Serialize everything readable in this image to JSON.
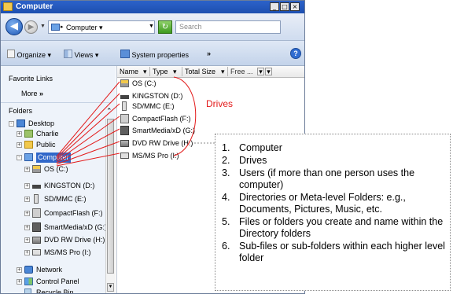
{
  "window": {
    "title": "Computer",
    "min_label": "_",
    "max_label": "□",
    "close_label": "×"
  },
  "address": {
    "path": "Computer",
    "search_placeholder": "Search"
  },
  "toolbar": {
    "organize": "Organize",
    "views": "Views",
    "system_properties": "System properties",
    "more": "»",
    "help": "?"
  },
  "nav": {
    "favorites_header": "Favorite Links",
    "more_label": "More",
    "more_chevron": "»",
    "folders_header": "Folders",
    "tree": [
      {
        "label": "Desktop",
        "icon": "desktop-icon"
      },
      {
        "label": "Charlie",
        "icon": "user-folder-icon"
      },
      {
        "label": "Public",
        "icon": "folder-icon"
      },
      {
        "label": "Computer",
        "icon": "computer-icon"
      },
      {
        "label": "OS (C:)",
        "icon": "os-drive-icon"
      },
      {
        "label": "KINGSTON (D:)",
        "icon": "usb-drive-icon"
      },
      {
        "label": "SD/MMC (E:)",
        "icon": "card-reader-icon"
      },
      {
        "label": "CompactFlash (F:)",
        "icon": "card-reader-icon"
      },
      {
        "label": "SmartMedia/xD (G:)",
        "icon": "card-reader-icon"
      },
      {
        "label": "DVD RW Drive (H:)",
        "icon": "dvd-drive-icon"
      },
      {
        "label": "MS/MS Pro (I:)",
        "icon": "card-reader-icon"
      },
      {
        "label": "Network",
        "icon": "network-icon"
      },
      {
        "label": "Control Panel",
        "icon": "control-panel-icon"
      },
      {
        "label": "Recycle Bin",
        "icon": "recycle-bin-icon"
      }
    ]
  },
  "file_pane": {
    "columns": [
      "Name",
      "Type",
      "Total Size",
      "Free ..."
    ],
    "drives": [
      "OS (C:)",
      "KINGSTON (D:)",
      "SD/MMC (E:)",
      "CompactFlash (F:)",
      "SmartMedia/xD (G:)",
      "DVD RW Drive (H:)",
      "MS/MS Pro (I:)"
    ]
  },
  "annotation": {
    "drives_label": "Drives",
    "line_color": "#e31a1a",
    "items": [
      {
        "num": "1.",
        "text": "Computer"
      },
      {
        "num": "2.",
        "text": "Drives"
      },
      {
        "num": "3.",
        "text": "Users (if more than one person uses the computer)"
      },
      {
        "num": "4.",
        "text": "Directories or Meta-level Folders: e.g., Documents, Pictures, Music, etc."
      },
      {
        "num": "5.",
        "text": "Files or folders you create and name within the Directory folders"
      },
      {
        "num": "6.",
        "text": "Sub-files or sub-folders within each higher level folder"
      }
    ]
  },
  "colors": {
    "titlebar": "#2c62c9",
    "selection": "#3067c9",
    "annotation": "#e31a1a"
  }
}
